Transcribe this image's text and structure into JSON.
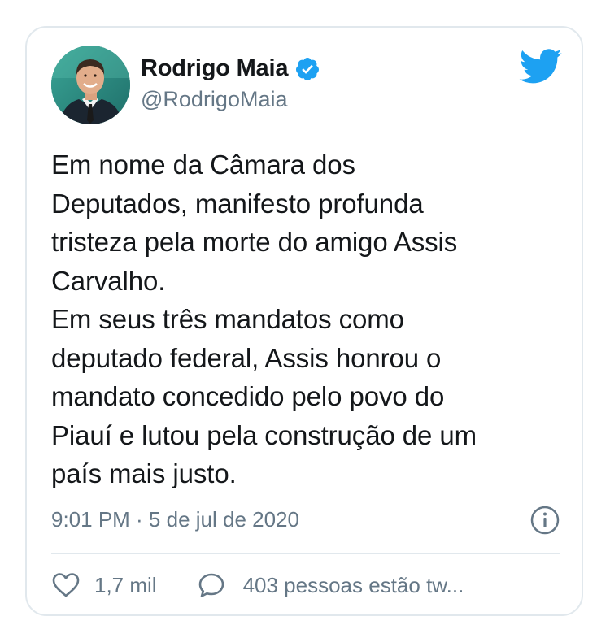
{
  "author": {
    "display_name": "Rodrigo Maia",
    "handle": "@RodrigoMaia",
    "verified": true,
    "avatar": "profile-photo"
  },
  "tweet": {
    "text": "Em nome da Câmara dos\nDeputados, manifesto profunda\ntristeza pela morte do amigo Assis\nCarvalho.\nEm seus três mandatos como\ndeputado federal, Assis honrou o\nmandato concedido pelo povo do\nPiauí e lutou pela construção de um\npaís mais justo.",
    "timestamp": "9:01 PM · 5 de jul de 2020"
  },
  "actions": {
    "like_count": "1,7 mil",
    "reply_text": "403 pessoas estão tw..."
  },
  "icons": {
    "brand": "twitter-bird-icon",
    "verified": "verified-badge-icon",
    "info": "info-icon",
    "like": "heart-icon",
    "reply": "speech-bubble-icon"
  },
  "colors": {
    "twitter_blue": "#1da1f2",
    "text_primary": "#14171a",
    "text_secondary": "#657786",
    "border": "#e1e8ed"
  }
}
